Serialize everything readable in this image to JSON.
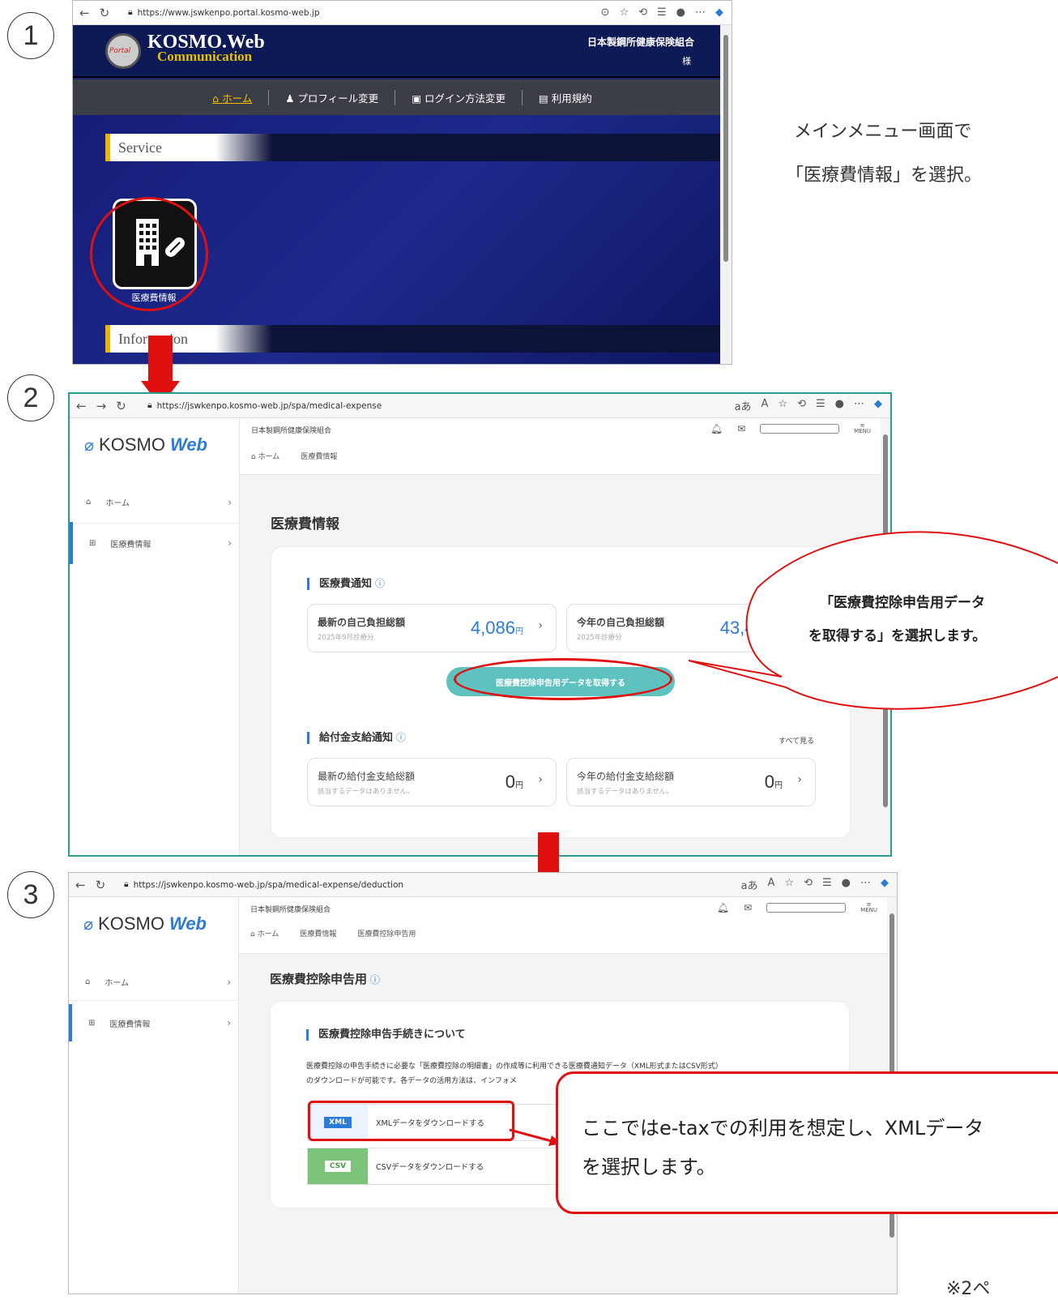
{
  "step_numbers": [
    "1",
    "2",
    "3"
  ],
  "browser": {
    "url1": "https://www.jswkenpo.portal.kosmo-web.jp",
    "url2": "https://jswkenpo.kosmo-web.jp/spa/medical-expense",
    "url3": "https://jswkenpo.kosmo-web.jp/spa/medical-expense/deduction",
    "reader_icon_label": "aあ"
  },
  "portal": {
    "logo_text": "KOSMO.Web",
    "logo_sub": "Communication",
    "logo_badge": "Portal",
    "org_name": "日本製鋼所健康保険組合",
    "user_suffix": "様",
    "menu": [
      "ホーム",
      "プロフィール変更",
      "ログイン方法変更",
      "利用規約"
    ],
    "section_service": "Service",
    "section_information": "Information",
    "tile_label": "医療費情報"
  },
  "note1": {
    "line1": "メインメニュー画面で",
    "line2": "「医療費情報」を選択。"
  },
  "kosmo": {
    "logo_left": "KOSMO",
    "logo_right": "Web",
    "org": "日本製鋼所健康保険組合",
    "menu_label": "MENU",
    "side": [
      "ホーム",
      "医療費情報"
    ],
    "crumb_home": "ホーム",
    "crumb_med": "医療費情報",
    "crumb_ded": "医療費控除申告用"
  },
  "page2": {
    "title": "医療費情報",
    "notice_heading": "医療費通知",
    "see_all": "すべて見る",
    "box1_title": "最新の自己負担総額",
    "box1_sub": "2025年9月診療分",
    "box1_value": "4,086",
    "box2_title": "今年の自己負担総額",
    "box2_sub": "2025年診療分",
    "box2_value": "43,458",
    "yen": "円",
    "button": "医療費控除申告用データを取得する",
    "benefit_heading": "給付金支給通知",
    "box3_title": "最新の給付金支給総額",
    "box3_sub": "該当するデータはありません。",
    "box3_value": "0",
    "box4_title": "今年の給付金支給総額",
    "box4_sub": "該当するデータはありません。",
    "box4_value": "0"
  },
  "callout2": {
    "line1": "「医療費控除申告用データ",
    "line2": "を取得する」を選択します。"
  },
  "page3": {
    "title": "医療費控除申告用",
    "heading": "医療費控除申告手続きについて",
    "desc1": "医療費控除の申告手続きに必要な「医療費控除の明細書」の作成等に利用できる医療費通知データ（XML形式またはCSV形式）",
    "desc2": "のダウンロードが可能です。各データの活用方法は、インフォメ",
    "xml_badge": "XML",
    "xml_label": "XMLデータをダウンロードする",
    "csv_badge": "CSV",
    "csv_label": "CSVデータをダウンロードする"
  },
  "callout3": {
    "line1": "ここではe-taxでの利用を想定し、XMLデータ",
    "line2": "を選択します。"
  },
  "footer_note": "※2ペ",
  "colors": {
    "teal": "#5ec2bf",
    "red": "#e01010",
    "blue": "#2b7bd8",
    "navy": "#0d1a55"
  }
}
